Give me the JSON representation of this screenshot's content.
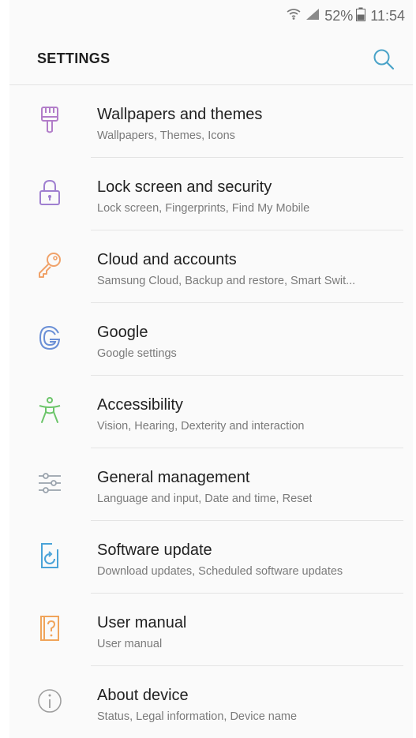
{
  "status_bar": {
    "battery_percent": "52%",
    "time": "11:54",
    "icons": [
      "wifi-icon",
      "signal-icon",
      "battery-icon"
    ]
  },
  "header": {
    "title": "SETTINGS",
    "search_icon": "search-icon"
  },
  "colors": {
    "accent": "#4aa3c8",
    "wallpaper_icon": "#b27dc9",
    "lock_icon": "#9f7fd0",
    "cloud_icon": "#f0a26a",
    "google_icon": "#6a8fd6",
    "accessibility_icon": "#6cc56a",
    "general_icon": "#9aa3ad",
    "software_icon": "#4aa3d8",
    "manual_icon": "#f0a45a",
    "about_icon": "#9e9e9e"
  },
  "items": [
    {
      "label": "Wallpapers and themes",
      "sub": "Wallpapers, Themes, Icons",
      "icon": "paintbrush-icon"
    },
    {
      "label": "Lock screen and security",
      "sub": "Lock screen, Fingerprints, Find My Mobile",
      "icon": "lock-icon"
    },
    {
      "label": "Cloud and accounts",
      "sub": "Samsung Cloud, Backup and restore, Smart Swit...",
      "icon": "key-icon"
    },
    {
      "label": "Google",
      "sub": "Google settings",
      "icon": "google-icon"
    },
    {
      "label": "Accessibility",
      "sub": "Vision, Hearing, Dexterity and interaction",
      "icon": "accessibility-icon"
    },
    {
      "label": "General management",
      "sub": "Language and input, Date and time, Reset",
      "icon": "sliders-icon"
    },
    {
      "label": "Software update",
      "sub": "Download updates, Scheduled software updates",
      "icon": "software-update-icon"
    },
    {
      "label": "User manual",
      "sub": "User manual",
      "icon": "question-book-icon"
    },
    {
      "label": "About device",
      "sub": "Status, Legal information, Device name",
      "icon": "info-icon"
    }
  ]
}
